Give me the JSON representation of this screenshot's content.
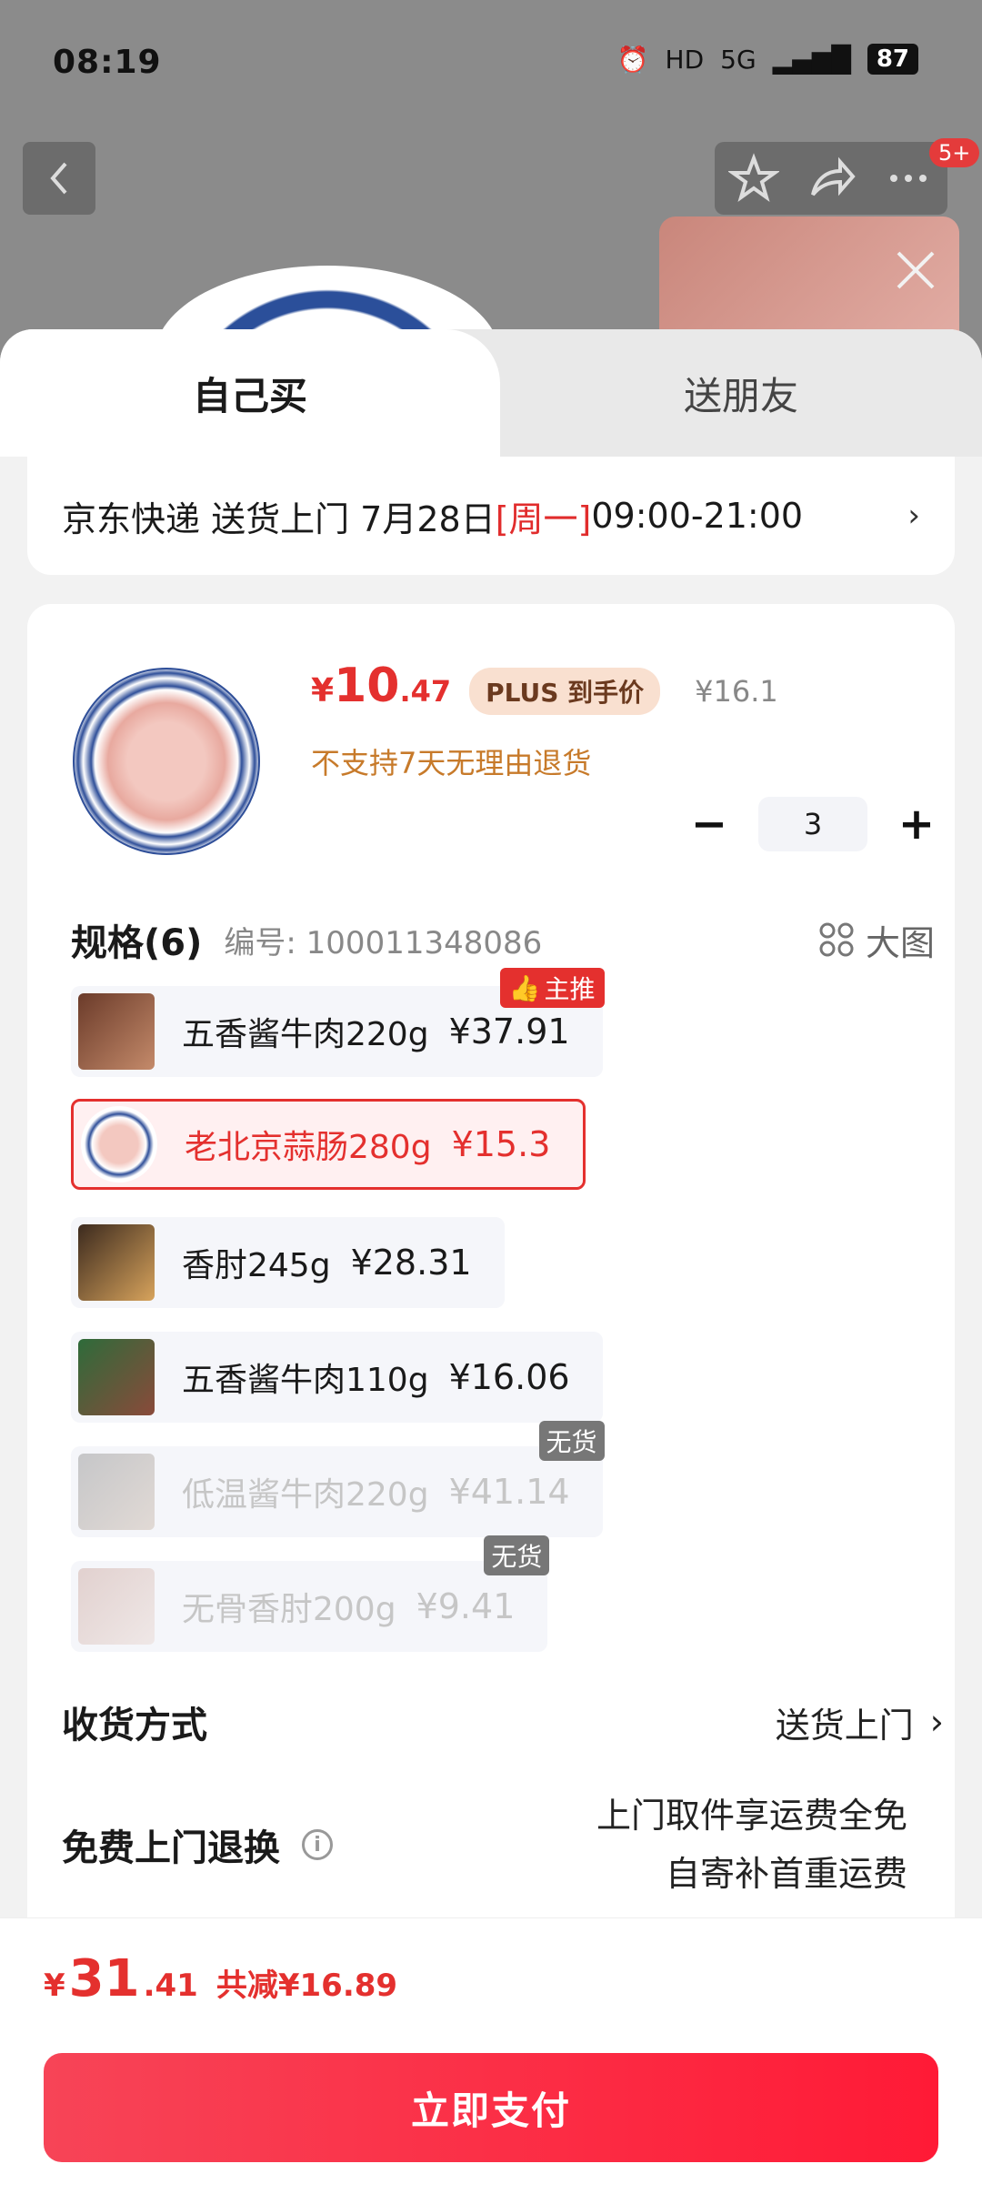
{
  "status_bar": {
    "time": "08:19",
    "battery": "87",
    "network": "5G"
  },
  "header": {
    "badge": "5+"
  },
  "tabs": [
    {
      "label": "自己买"
    },
    {
      "label": "送朋友"
    }
  ],
  "delivery": {
    "prefix": "京东快递 送货上门 7月28日 ",
    "weekday": "[周一]",
    "time_range": " 09:00-21:00"
  },
  "product": {
    "price_symbol": "¥",
    "price_int": "10",
    "price_dec": ".47",
    "plus_tag": "PLUS 到手价",
    "original_price": "¥16.1",
    "return_note": "不支持7天无理由退货",
    "quantity": "3"
  },
  "spec": {
    "title": "规格(6)",
    "code": "编号: 100011348086",
    "big_image_label": "大图",
    "options": [
      {
        "label": "五香酱牛肉220g",
        "price": "¥37.91",
        "tag": "主推",
        "state": "normal"
      },
      {
        "label": "老北京蒜肠280g",
        "price": "¥15.3",
        "tag": "",
        "state": "selected"
      },
      {
        "label": "香肘245g",
        "price": "¥28.31",
        "tag": "",
        "state": "normal"
      },
      {
        "label": "五香酱牛肉110g",
        "price": "¥16.06",
        "tag": "",
        "state": "normal"
      },
      {
        "label": "低温酱牛肉220g",
        "price": "¥41.14",
        "tag": "无货",
        "state": "disabled"
      },
      {
        "label": "无骨香肘200g",
        "price": "¥9.41",
        "tag": "无货",
        "state": "disabled"
      }
    ]
  },
  "shipping": {
    "title": "收货方式",
    "value": "送货上门"
  },
  "returns": {
    "title": "免费上门退换",
    "line1": "上门取件享运费全免",
    "line2": "自寄补首重运费"
  },
  "footer": {
    "total_symbol": "¥",
    "total_int": "31",
    "total_dec": ".41",
    "discount": "共减¥16.89",
    "pay_label": "立即支付"
  },
  "colors": {
    "accent": "#e4302e",
    "pay_button": "#ff1a36"
  }
}
